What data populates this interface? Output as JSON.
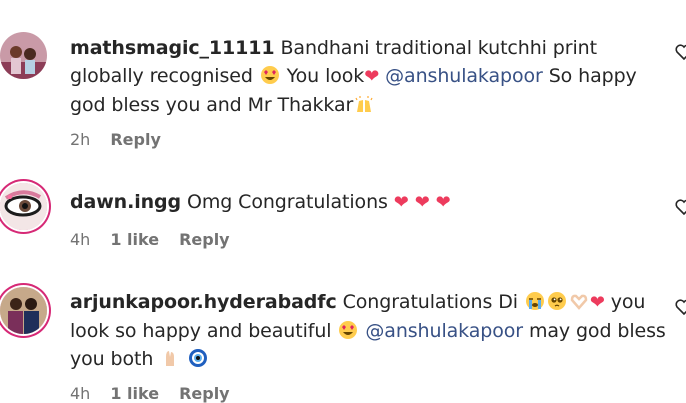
{
  "comments": [
    {
      "username": "mathsmagic_11111",
      "text_1": " Bandhani traditional kutchhi print globally recognised ",
      "text_2": " You look",
      "mention": "@anshulakapoor",
      "text_3": " So happy god bless you and Mr Thakkar",
      "time": "2h",
      "reply": "Reply"
    },
    {
      "username": "dawn.ingg",
      "text_1": " Omg Congratulations ",
      "time": "4h",
      "likes": "1 like",
      "reply": "Reply"
    },
    {
      "username": "arjunkapoor.hyderabadfc",
      "text_1": " Congratulations Di ",
      "text_2": " you look so happy and beautiful ",
      "mention": "@anshulakapoor",
      "text_3": " may god bless you both ",
      "time": "4h",
      "likes": "1 like",
      "reply": "Reply"
    }
  ],
  "colors": {
    "mention": "#385185",
    "heart": "#ed3b5d",
    "ring": "#d62976",
    "meta": "#737373"
  }
}
